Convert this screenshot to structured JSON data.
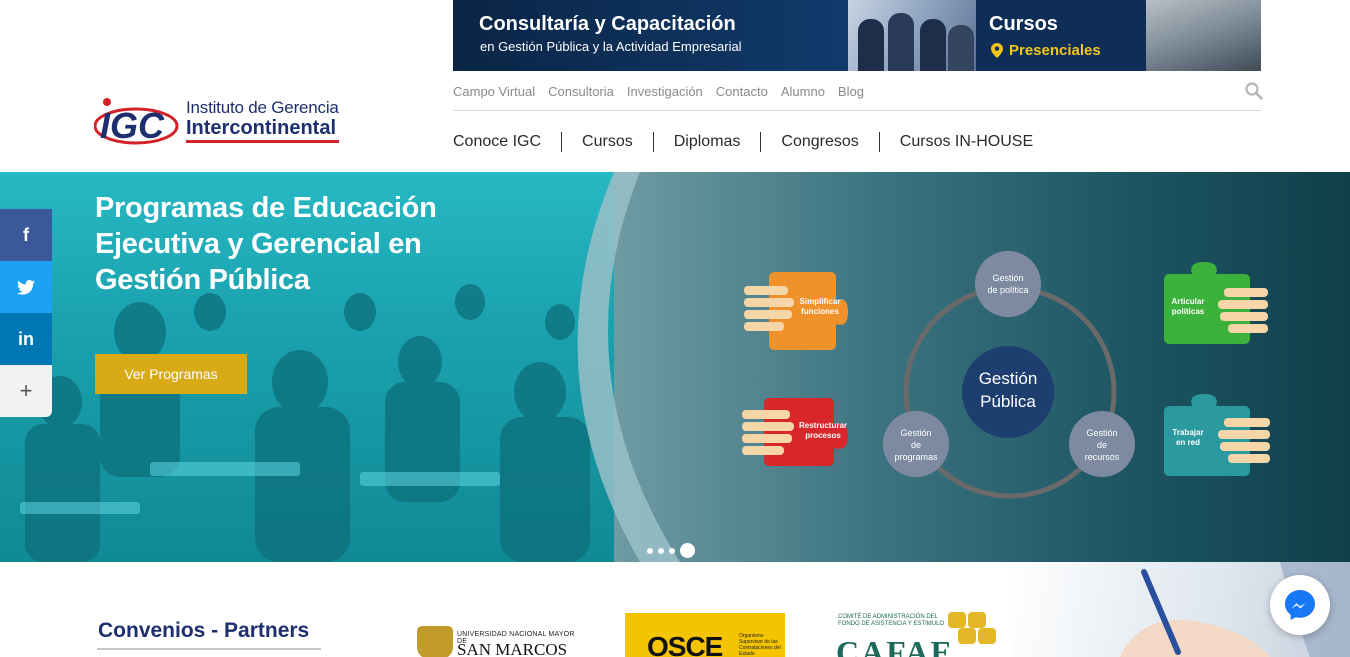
{
  "brand": {
    "logo_mark": "IGC",
    "name_line1": "Instituto de Gerencia",
    "name_line2": "Intercontinental"
  },
  "top_banner": {
    "title": "Consultaría y Capacitación",
    "subtitle": "en Gestión Pública y la Actividad Empresarial",
    "courses_title": "Cursos",
    "courses_subtitle": "Presenciales"
  },
  "utility_nav": [
    "Campo Virtual",
    "Consultoria",
    "Investigación",
    "Contacto",
    "Alumno",
    "Blog"
  ],
  "main_nav": [
    "Conoce IGC",
    "Cursos",
    "Diplomas",
    "Congresos",
    "Cursos IN-HOUSE"
  ],
  "hero": {
    "headline": "Programas de Educación Ejecutiva y Gerencial en Gestión Pública",
    "cta_label": "Ver Programas",
    "slide_count": 4,
    "active_slide": 4
  },
  "diagram": {
    "center": [
      "Gestión",
      "Pública"
    ],
    "nodes": {
      "politica": [
        "Gestión",
        "de política"
      ],
      "programas": [
        "Gestión",
        "de",
        "programas"
      ],
      "recursos": [
        "Gestión",
        "de",
        "recursos"
      ]
    },
    "puzzles": {
      "simplificar": [
        "Simplificar",
        "funciones"
      ],
      "restructurar": [
        "Restructurar",
        "procesos"
      ],
      "articular": [
        "Articular",
        "políticas"
      ],
      "trabajar": [
        "Trabajar",
        "en red"
      ]
    }
  },
  "social": {
    "facebook": "f",
    "twitter": "twitter-bird-icon",
    "linkedin": "in",
    "more": "+"
  },
  "partners": {
    "title": "Convenios - Partners",
    "unmsm_top": "UNIVERSIDAD NACIONAL MAYOR DE",
    "unmsm_name": "SAN MARCOS",
    "osce": "OSCE",
    "osce_desc": "Organismo Supervisor de las Contrataciones del Estado",
    "cafae_desc": "COMITÉ DE ADMINISTRACIÓN DEL FONDO DE ASISTENCIA Y ESTIMULO",
    "cafae": "CAFAE"
  },
  "colors": {
    "brand_blue": "#1d2f6e",
    "brand_red": "#d3232a",
    "cta_gold": "#d8aa16",
    "facebook": "#3b5998",
    "twitter": "#1da1f2",
    "linkedin": "#0077b5"
  }
}
